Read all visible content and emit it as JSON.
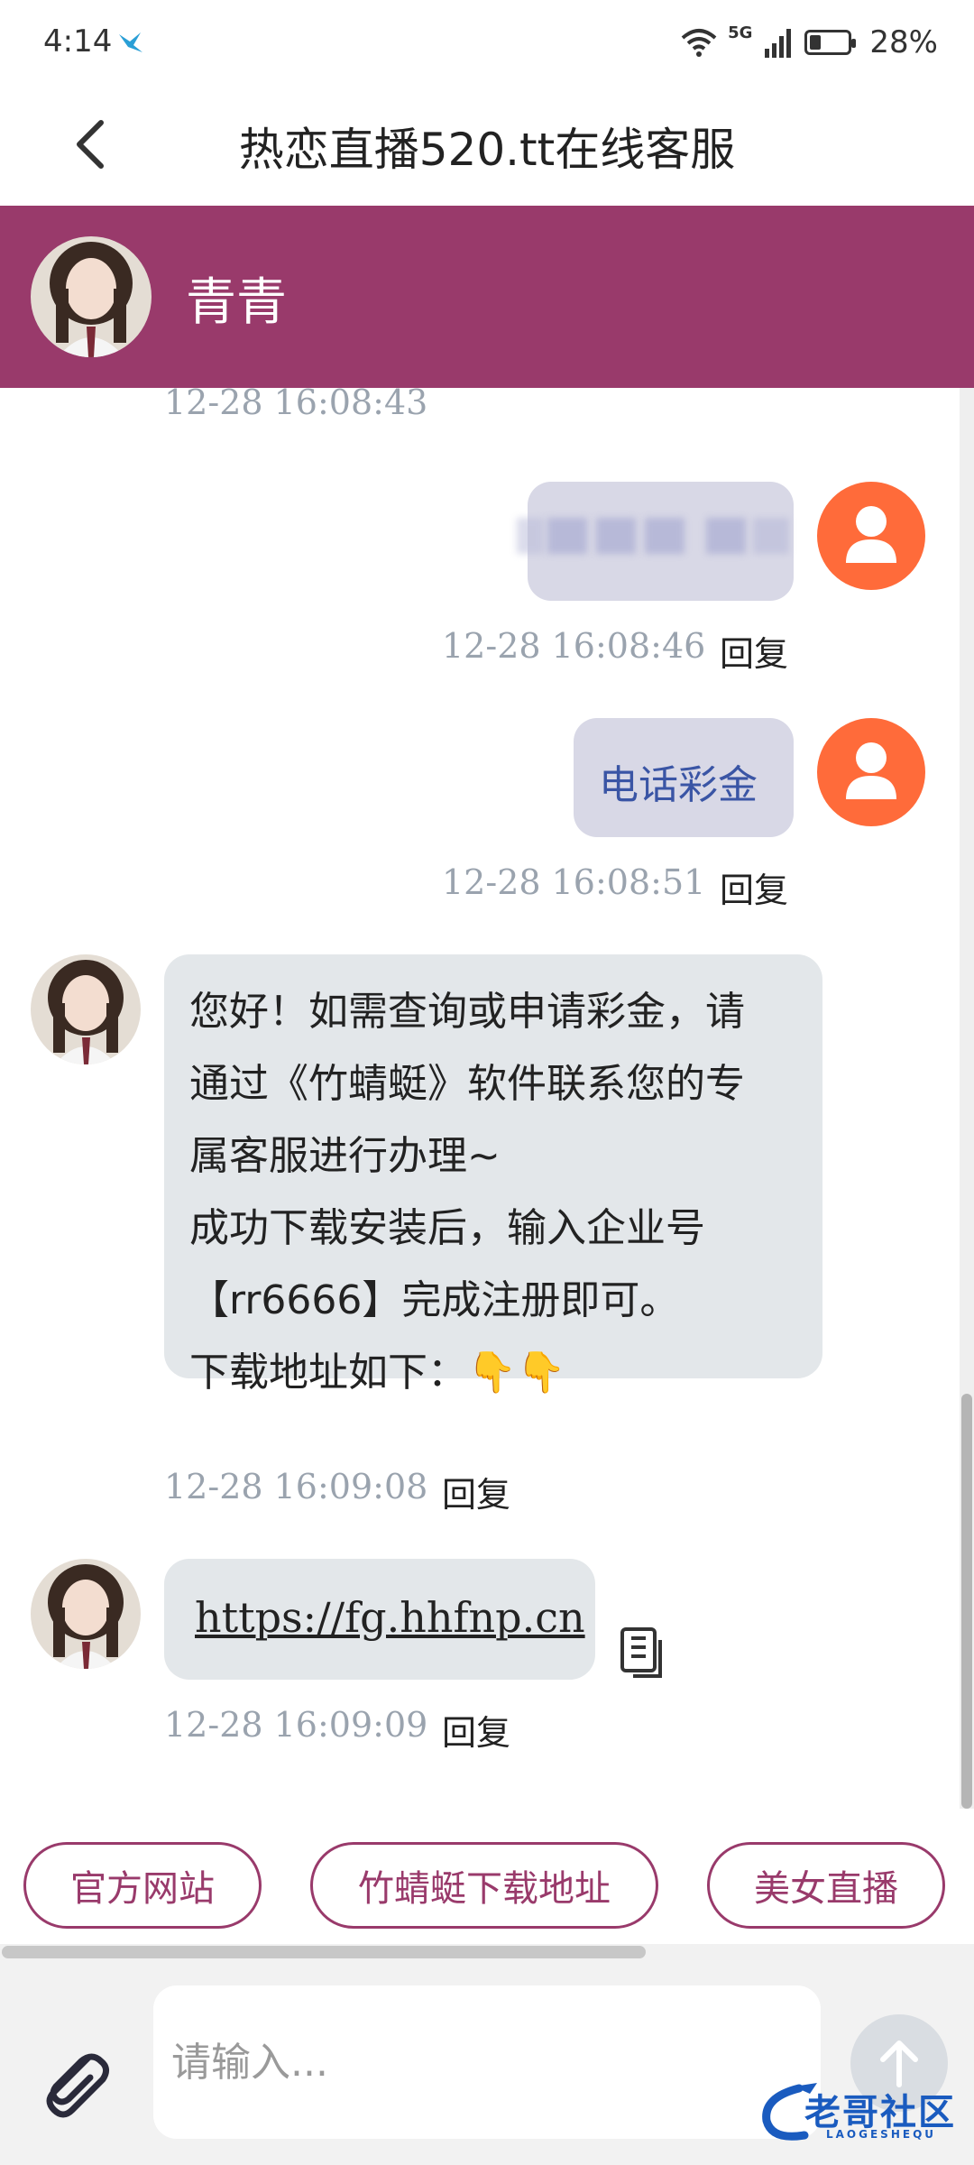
{
  "status_bar": {
    "time": "4:14",
    "network": "5G",
    "battery": "28%"
  },
  "header": {
    "title": "热恋直播520.tt在线客服"
  },
  "agent": {
    "name": "青青"
  },
  "messages": [
    {
      "timestamp": "12-28 16:08:43"
    },
    {
      "direction": "out",
      "text_obscured": true,
      "timestamp": "12-28 16:08:46",
      "reply_label": "回复"
    },
    {
      "direction": "out",
      "text": "电话彩金",
      "timestamp": "12-28 16:08:51",
      "reply_label": "回复"
    },
    {
      "direction": "in",
      "text": "您好！如需查询或申请彩金，请\n通过《竹蜻蜓》软件联系您的专\n属客服进行办理~\n成功下载安装后，输入企业号\n【rr6666】完成注册即可。\n下载地址如下：👇👇",
      "timestamp": "12-28 16:09:08",
      "reply_label": "回复"
    },
    {
      "direction": "in",
      "text": "https://fg.hhfnp.cn",
      "timestamp": "12-28 16:09:09",
      "reply_label": "回复"
    }
  ],
  "quick_buttons": [
    {
      "label": "官方网站"
    },
    {
      "label": "竹蜻蜓下载地址"
    },
    {
      "label": "美女直播"
    }
  ],
  "input": {
    "placeholder": "请输入..."
  },
  "watermark": {
    "text": "老哥社区",
    "subtext": "LAOGESHEQU"
  },
  "colors": {
    "brand": "#993a6b",
    "user_avatar": "#ff6b3a",
    "outgoing_bubble": "#d8d8e6",
    "incoming_bubble": "#e3e7ea"
  }
}
